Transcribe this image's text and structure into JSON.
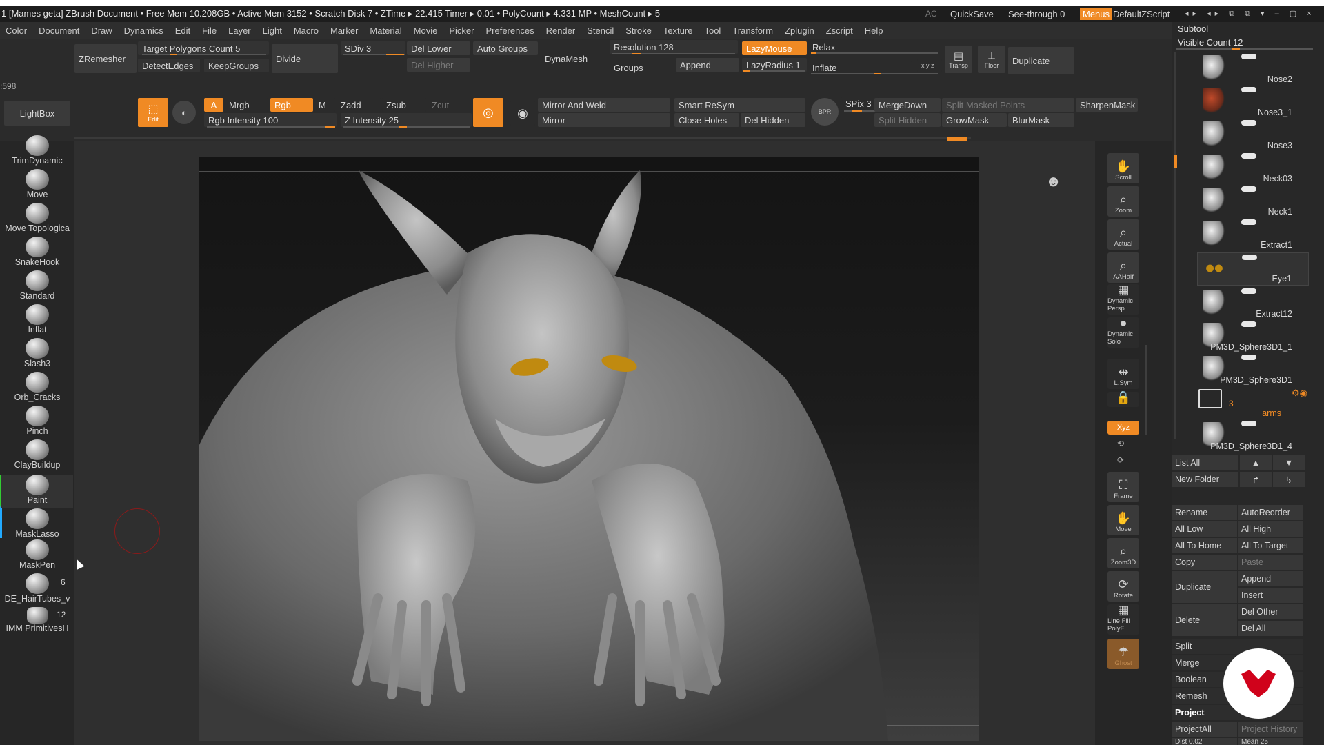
{
  "titlebar": {
    "title": "1 [Mames geta]   ZBrush Document     • Free Mem 10.208GB • Active Mem 3152 • Scratch Disk 7 •  ZTime ▸ 22.415  Timer ▸ 0.01 • PolyCount ▸ 4.331 MP   • MeshCount ▸ 5",
    "ac": "AC",
    "quicksave": "QuickSave",
    "see_through": "See-through  0",
    "menus": "Menus",
    "script": "DefaultZScript"
  },
  "menubar": [
    "Color",
    "Document",
    "Draw",
    "Dynamics",
    "Edit",
    "File",
    "Layer",
    "Light",
    "Macro",
    "Marker",
    "Material",
    "Movie",
    "Picker",
    "Preferences",
    "Render",
    "Stencil",
    "Stroke",
    "Texture",
    "Tool",
    "Transform",
    "Zplugin",
    "Zscript",
    "Help"
  ],
  "shelf": {
    "zremesher": "ZRemesher",
    "target_polygons": "Target Polygons Count 5",
    "detect_edges": "DetectEdges",
    "keep_groups": "KeepGroups",
    "divide": "Divide",
    "sdiv": "SDiv 3",
    "del_lower": "Del Lower",
    "del_higher": "Del Higher",
    "auto_groups": "Auto Groups",
    "dynamesh": "DynaMesh",
    "resolution": "Resolution 128",
    "groups": "Groups",
    "append": "Append",
    "lazymouse": "LazyMouse",
    "lazyradius": "LazyRadius 1",
    "relax": "Relax",
    "inflate": "Inflate",
    "xyz_small": "x y z",
    "transp": "Transp",
    "floor": "Floor",
    "duplicate": "Duplicate",
    "coord": "598",
    "lightbox": "LightBox",
    "edit": "Edit",
    "a": "A",
    "mrgb": "Mrgb",
    "rgb": "Rgb",
    "m": "M",
    "zadd": "Zadd",
    "zsub": "Zsub",
    "zcut": "Zcut",
    "rgb_intensity": "Rgb Intensity 100",
    "z_intensity": "Z Intensity 25",
    "mirror_weld": "Mirror And Weld",
    "mirror": "Mirror",
    "smart_resym": "Smart ReSym",
    "close_holes": "Close Holes",
    "del_hidden": "Del Hidden",
    "bpr": "BPR",
    "spix": "SPix 3",
    "mergedown": "MergeDown",
    "split_masked": "Split Masked Points",
    "split_hidden": "Split Hidden",
    "growmask": "GrowMask",
    "blurmask": "BlurMask",
    "sharpenmask": "SharpenMask"
  },
  "brushes": [
    {
      "label": "TrimDynamic"
    },
    {
      "label": "Move"
    },
    {
      "label": "Move Topologica"
    },
    {
      "label": "SnakeHook"
    },
    {
      "label": "Standard"
    },
    {
      "label": "Inflat"
    },
    {
      "label": "Slash3"
    },
    {
      "label": "Orb_Cracks"
    },
    {
      "label": "Pinch"
    },
    {
      "label": "ClayBuildup"
    },
    {
      "label": "Paint"
    },
    {
      "label": "MaskLasso"
    },
    {
      "label": "MaskPen"
    },
    {
      "label": "DE_HairTubes_v",
      "count": "6"
    },
    {
      "label": "IMM PrimitivesH",
      "count": "12"
    }
  ],
  "rightbar": [
    {
      "label": "Scroll"
    },
    {
      "label": "Zoom"
    },
    {
      "label": "Actual"
    },
    {
      "label": "AAHalf"
    },
    {
      "label": "Dynamic Persp"
    },
    {
      "label": "Dynamic Solo"
    },
    {
      "label": "L.Sym"
    },
    {
      "label": "Xyz"
    },
    {
      "label": "Frame"
    },
    {
      "label": "Move"
    },
    {
      "label": "Zoom3D"
    },
    {
      "label": "Rotate"
    },
    {
      "label": "Line Fill PolyF"
    },
    {
      "label": "Ghost"
    }
  ],
  "panel": {
    "title": "Subtool",
    "visible_count": "Visible Count 12",
    "subtools": [
      "Nose2",
      "Nose3_1",
      "Nose3",
      "Neck03",
      "Neck1",
      "Extract1",
      "Eye1",
      "Extract12",
      "PM3D_Sphere3D1_1",
      "PM3D_Sphere3D1",
      "arms",
      "PM3D_Sphere3D1_4"
    ],
    "folder_count": "3",
    "list_all": "List All",
    "new_folder": "New Folder",
    "rename": "Rename",
    "autoreorder": "AutoReorder",
    "all_low": "All Low",
    "all_high": "All High",
    "all_to_home": "All To Home",
    "all_to_target": "All To Target",
    "copy": "Copy",
    "paste": "Paste",
    "duplicate": "Duplicate",
    "append": "Append",
    "insert": "Insert",
    "delete": "Delete",
    "del_other": "Del Other",
    "del_all": "Del All",
    "split": "Split",
    "merge": "Merge",
    "boolean": "Boolean",
    "remesh": "Remesh",
    "project": "Project",
    "projectall": "ProjectAll",
    "project_history": "Project History",
    "dist": "Dist 0.02",
    "mean": "Mean 25"
  },
  "colors": {
    "accent": "#f08a24",
    "logo": "#d0021b"
  }
}
